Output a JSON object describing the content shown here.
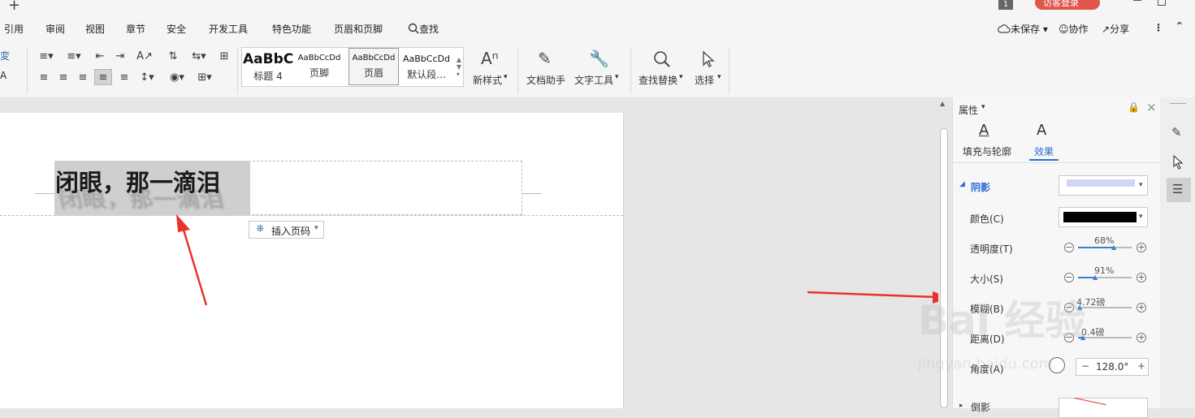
{
  "titlebar": {
    "plus": "+",
    "badge_num": "1",
    "login_button": "访客登录"
  },
  "menu_tabs": [
    "引用",
    "审阅",
    "视图",
    "章节",
    "安全",
    "开发工具",
    "特色功能",
    "页眉和页脚"
  ],
  "search_tab": "查找",
  "top_right": {
    "unsaved": "未保存",
    "collab": "协作",
    "share": "分享"
  },
  "styles": [
    {
      "sample": "AaBbC",
      "name": "标题 4"
    },
    {
      "sample": "AaBbCcDd",
      "name": "页脚"
    },
    {
      "sample": "AaBbCcDd",
      "name": "页眉"
    },
    {
      "sample": "AaBbCcDd",
      "name": "默认段..."
    }
  ],
  "ribbon_buttons": {
    "new_style": "新样式",
    "doc_helper": "文档助手",
    "text_tools": "文字工具",
    "find_replace": "查找替换",
    "select": "选择",
    "left_glyph_1": "変",
    "left_glyph_2": "A"
  },
  "document": {
    "header_text": "闭眼，那一滴泪",
    "insert_page_number": "插入页码"
  },
  "panel": {
    "title": "属性",
    "tab_fill": "填充与轮廓",
    "tab_effect": "效果",
    "shadow_section": "阴影",
    "color_label": "颜色(C)",
    "color_value": "#000000",
    "transparency_label": "透明度(T)",
    "transparency_value": "68%",
    "transparency_level": 0.68,
    "size_label": "大小(S)",
    "size_value": "91%",
    "size_level": 0.33,
    "blur_label": "模糊(B)",
    "blur_value": "4.72磅",
    "blur_level": 0.05,
    "distance_label": "距离(D)",
    "distance_value": "0.4磅",
    "distance_level": 0.1,
    "angle_label": "角度(A)",
    "angle_value": "128.0°",
    "reflection_label": "倒影"
  },
  "watermark": {
    "brand": "Bai 经验",
    "url": "jingyan.baidu.com"
  }
}
